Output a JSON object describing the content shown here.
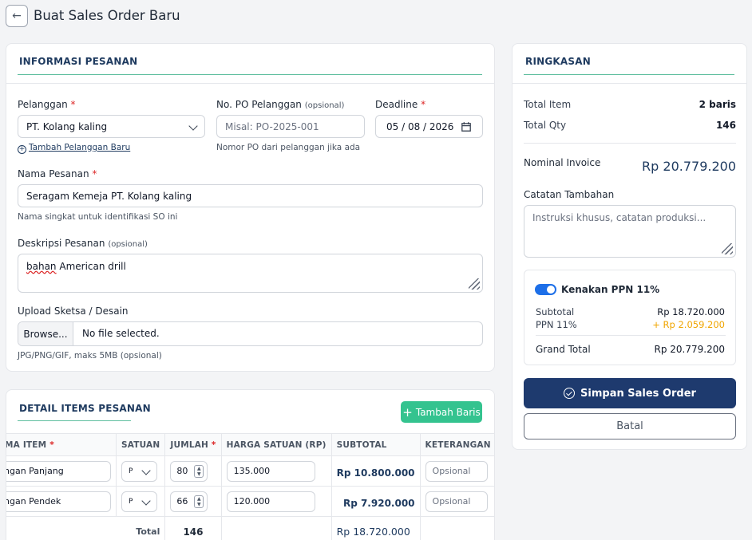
{
  "header": {
    "title": "Buat Sales Order Baru",
    "back_icon": "←"
  },
  "info": {
    "heading": "INFORMASI PESANAN",
    "customer": {
      "label": "Pelanggan",
      "value": "PT. Kolang kaling",
      "add_link": "Tambah Pelanggan Baru"
    },
    "po": {
      "label": "No. PO Pelanggan",
      "optional": "(opsional)",
      "placeholder": "Misal: PO-2025-001",
      "help": "Nomor PO dari pelanggan jika ada"
    },
    "deadline": {
      "label": "Deadline",
      "value": "05 / 08 / 2026"
    },
    "order_name": {
      "label": "Nama Pesanan",
      "value": "Seragam Kemeja PT. Kolang kaling",
      "help": "Nama singkat untuk identifikasi SO ini"
    },
    "description": {
      "label": "Deskripsi Pesanan",
      "optional": "(opsional)",
      "value_word1": "bahan",
      "value_rest": " American drill"
    },
    "upload": {
      "label": "Upload Sketsa / Desain",
      "button": "Browse...",
      "status": "No file selected.",
      "help": "JPG/PNG/GIF, maks 5MB (opsional)"
    },
    "required_mark": "*"
  },
  "items": {
    "heading": "DETAIL ITEMS PESANAN",
    "add_button": "Tambah Baris",
    "columns": {
      "name": "MA ITEM",
      "unit": "SATUAN",
      "qty": "JUMLAH",
      "price": "HARGA SATUAN (RP)",
      "subtotal": "SUBTOTAL",
      "note": "KETERANGAN"
    },
    "rows": [
      {
        "name": "ngan Panjang",
        "unit": "P",
        "qty": "80",
        "price": "135.000",
        "subtotal": "Rp 10.800.000",
        "note_placeholder": "Opsional"
      },
      {
        "name": "ngan Pendek",
        "unit": "P",
        "qty": "66",
        "price": "120.000",
        "subtotal": "Rp 7.920.000",
        "note_placeholder": "Opsional"
      }
    ],
    "total_label": "Total",
    "total_qty": "146",
    "total_amount": "Rp 18.720.000"
  },
  "summary": {
    "heading": "RINGKASAN",
    "total_item_label": "Total Item",
    "total_item_value": "2 baris",
    "total_qty_label": "Total Qty",
    "total_qty_value": "146",
    "invoice_label": "Nominal Invoice",
    "invoice_value": "Rp 20.779.200",
    "notes_label": "Catatan Tambahan",
    "notes_placeholder": "Instruksi khusus, catatan produksi...",
    "ppn_toggle_label": "Kenakan PPN 11%",
    "subtotal_label": "Subtotal",
    "subtotal_value": "Rp 18.720.000",
    "ppn_label": "PPN 11%",
    "ppn_value": "+ Rp 2.059.200",
    "grand_total_label": "Grand Total",
    "grand_total_value": "Rp 20.779.200",
    "save_button": "Simpan Sales Order",
    "cancel_button": "Batal"
  },
  "colors": {
    "navy": "#1e3a6e",
    "accent_green": "#34c38f",
    "required_red": "#dc2626",
    "ppn_orange": "#f0a500",
    "toggle_blue": "#1d6fe8"
  }
}
